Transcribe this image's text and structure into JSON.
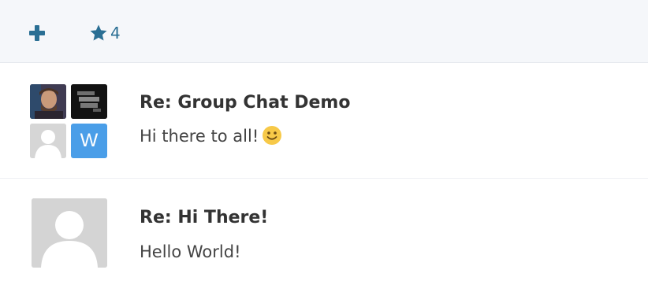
{
  "toolbar": {
    "add_icon": "plus-icon",
    "favorites_icon": "star-icon",
    "favorites_count": "4",
    "accent_color": "#2a6f94"
  },
  "conversations": [
    {
      "title": "Re: Group Chat Demo",
      "preview": "Hi there to all!",
      "preview_emoji": "slightly-smiling-face",
      "participant_avatars": [
        "photo-avatar",
        "game-cover-avatar",
        "default-avatar",
        "letter-avatar"
      ],
      "letter_avatar_initial": "W",
      "letter_avatar_color": "#4a9ee8"
    },
    {
      "title": "Re: Hi There!",
      "preview": "Hello World!",
      "participant_avatars": [
        "default-avatar"
      ]
    }
  ]
}
